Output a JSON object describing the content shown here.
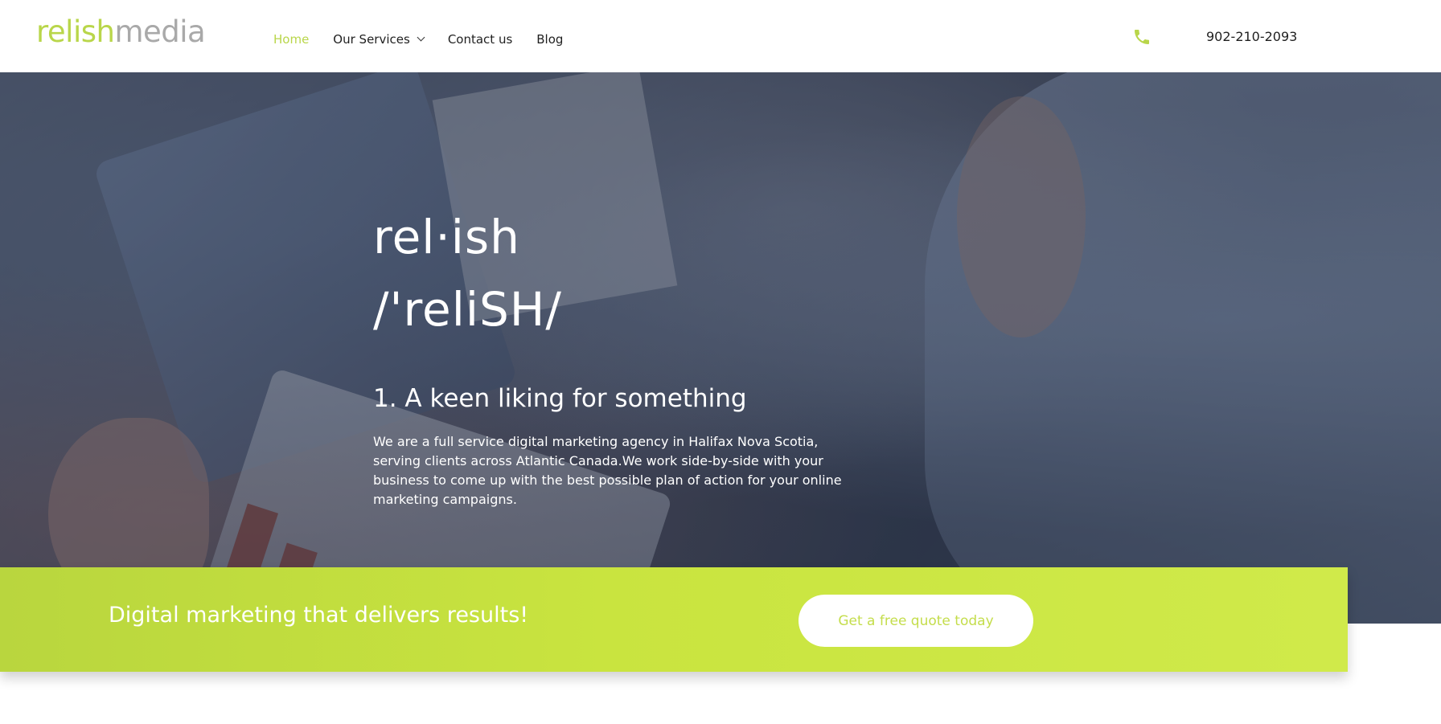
{
  "header": {
    "logo": {
      "part1": "relish",
      "part2": "media"
    },
    "nav": [
      {
        "label": "Home",
        "active": true
      },
      {
        "label": "Our Services",
        "has_dropdown": true
      },
      {
        "label": "Contact us"
      },
      {
        "label": "Blog"
      }
    ],
    "phone": "902-210-2093",
    "phone_icon": "phone-icon"
  },
  "hero": {
    "word": "rel·ish",
    "pronunciation": "/'reliSH/",
    "definition": "1. A keen liking for something",
    "description": "We are a full service digital marketing agency in Halifax Nova Scotia, serving clients across Atlantic Canada.We work side-by-side with your business to come up with the best possible plan of action for your online marketing campaigns."
  },
  "banner": {
    "title": "Digital marketing that delivers results!",
    "button_label": "Get a free quote today"
  },
  "colors": {
    "brand_green": "#b9d64a",
    "logo_gray": "#a9a9a9",
    "banner_green": "#c9e43f"
  }
}
